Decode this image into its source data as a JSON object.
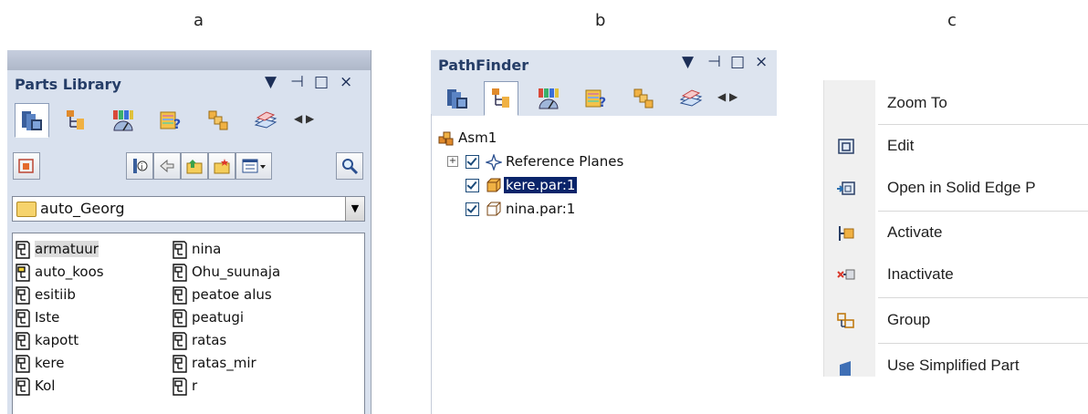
{
  "labels": {
    "a": "a",
    "b": "b",
    "c": "c"
  },
  "parts_library": {
    "title": "Parts Library",
    "window_controls": [
      "▼",
      "⊣",
      "□",
      "×"
    ],
    "tabs": [
      "parts-library-tab-icon",
      "pathfinder-tab-icon",
      "sensors-tab-icon",
      "feature-library-tab-icon",
      "family-members-tab-icon",
      "layers-tab-icon"
    ],
    "nav": "◀ ▶",
    "folder": "auto_Georg",
    "files_col1": [
      "armatuur",
      "auto_koos",
      "esitiib",
      "Iste",
      "kapott",
      "kere",
      "Kol"
    ],
    "files_col2": [
      "nina",
      "Ohu_suunaja",
      "peatoe alus",
      "peatugi",
      "ratas",
      "ratas_mir",
      "r"
    ]
  },
  "pathfinder": {
    "title": "PathFinder",
    "window_controls": [
      "▼",
      "⊣",
      "□",
      "×"
    ],
    "nav": "◀ ▶",
    "tree": {
      "root": "Asm1",
      "expander": "+",
      "reference_planes": "Reference Planes",
      "part1": "kere.par:1",
      "part2": "nina.par:1"
    }
  },
  "context_menu": {
    "items": [
      {
        "label": "Zoom To",
        "icon": ""
      },
      {
        "label": "Edit",
        "icon": "edit-icon"
      },
      {
        "label": "Open in Solid Edge P",
        "icon": "open-in-part-icon"
      },
      {
        "label": "Activate",
        "icon": "activate-icon"
      },
      {
        "label": "Inactivate",
        "icon": "inactivate-icon"
      },
      {
        "label": "Group",
        "icon": "group-icon"
      },
      {
        "label": "Use Simplified Part",
        "icon": "simplified-part-icon"
      }
    ]
  },
  "colors": {
    "accent_title": "#253d67",
    "selection": "#0a246a",
    "panel_bg": "#d9e1ee"
  }
}
